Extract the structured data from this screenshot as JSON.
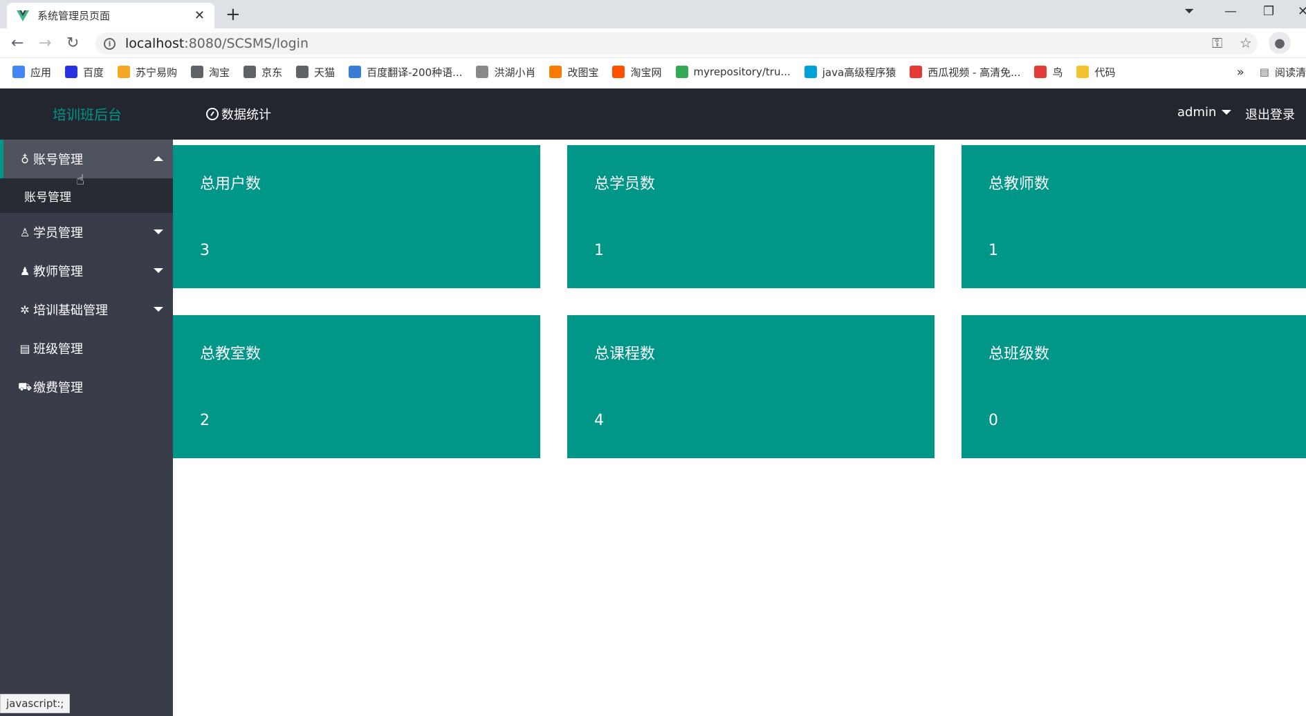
{
  "browser": {
    "tab_title": "系统管理员页面",
    "url_host": "localhost",
    "url_rest": ":8080/SCSMS/login",
    "bookmarks": [
      {
        "label": "应用",
        "color": "#4285f4"
      },
      {
        "label": "百度",
        "color": "#2932e1"
      },
      {
        "label": "苏宁易购",
        "color": "#f5a623"
      },
      {
        "label": "淘宝",
        "color": "#5f6368"
      },
      {
        "label": "京东",
        "color": "#5f6368"
      },
      {
        "label": "天猫",
        "color": "#5f6368"
      },
      {
        "label": "百度翻译-200种语...",
        "color": "#3a7bd5"
      },
      {
        "label": "洪湖小肖",
        "color": "#888888"
      },
      {
        "label": "改图宝",
        "color": "#f57c00"
      },
      {
        "label": "淘宝网",
        "color": "#ff5000"
      },
      {
        "label": "myrepository/tru...",
        "color": "#34a853"
      },
      {
        "label": "java高级程序猿",
        "color": "#00a1d6"
      },
      {
        "label": "西瓜视频 - 高清免...",
        "color": "#e53935"
      },
      {
        "label": "鸟",
        "color": "#e53935"
      },
      {
        "label": "代码",
        "color": "#f1c232"
      }
    ],
    "reading_mode": "阅读清"
  },
  "header": {
    "brand": "培训班后台",
    "nav_label": "数据统计",
    "user": "admin",
    "logout": "退出登录"
  },
  "sidebar": {
    "items": [
      {
        "label": "账号管理",
        "icon": "lightbulb-icon",
        "expanded": true,
        "sub": "账号管理"
      },
      {
        "label": "学员管理",
        "icon": "user-icon"
      },
      {
        "label": "教师管理",
        "icon": "person-icon"
      },
      {
        "label": "培训基础管理",
        "icon": "gear-icon"
      },
      {
        "label": "班级管理",
        "icon": "clipboard-icon"
      },
      {
        "label": "缴费管理",
        "icon": "cart-icon"
      }
    ]
  },
  "cards": [
    {
      "title": "总用户数",
      "value": "3"
    },
    {
      "title": "总学员数",
      "value": "1"
    },
    {
      "title": "总教师数",
      "value": "1"
    },
    {
      "title": "总教室数",
      "value": "2"
    },
    {
      "title": "总课程数",
      "value": "4"
    },
    {
      "title": "总班级数",
      "value": "0"
    }
  ],
  "status_text": "javascript:;",
  "colors": {
    "accent": "#009688",
    "header": "#23262e",
    "sidebar": "#393d49"
  }
}
